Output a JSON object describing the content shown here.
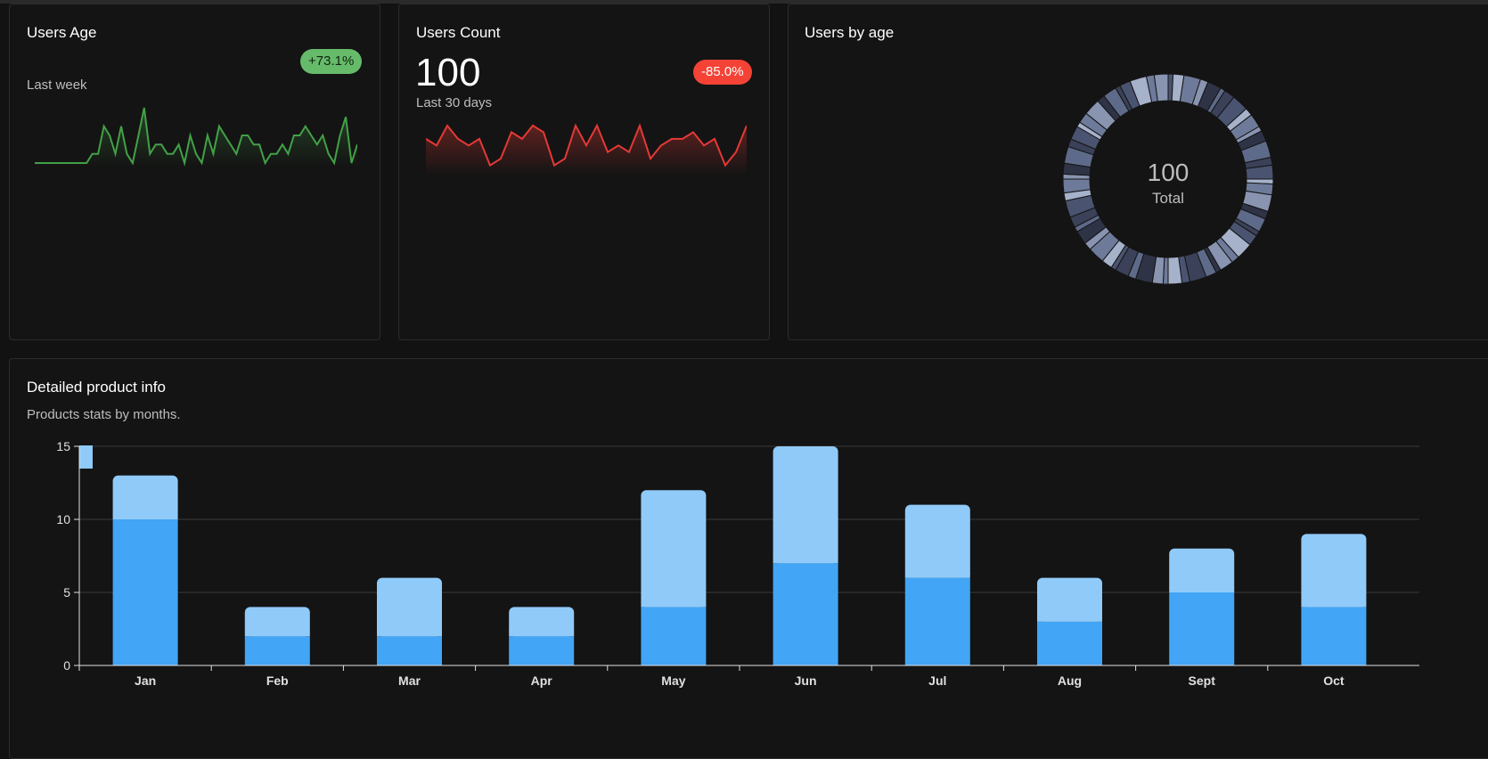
{
  "cards": {
    "users_age": {
      "title": "Users Age",
      "badge": "+73.1%",
      "period": "Last week",
      "badge_color": "#66bb6a",
      "line_color": "#43a047"
    },
    "users_count": {
      "title": "Users Count",
      "value": "100",
      "badge": "-85.0%",
      "period": "Last 30 days",
      "badge_color": "#f44336",
      "line_color": "#e53935"
    },
    "users_by_age": {
      "title": "Users by age",
      "center_value": "100",
      "center_label": "Total"
    },
    "product": {
      "title": "Detailed product info",
      "subtitle": "Products stats by months."
    }
  },
  "sparkline_age": [
    0,
    0,
    0,
    0,
    0,
    0,
    0,
    0,
    0,
    0,
    1,
    1,
    4,
    3,
    1,
    4,
    1,
    0,
    3,
    6,
    1,
    2,
    2,
    1,
    1,
    2,
    0,
    3,
    1,
    0,
    3,
    1,
    4,
    3,
    2,
    1,
    3,
    3,
    2,
    2,
    0,
    1,
    1,
    2,
    1,
    3,
    3,
    4,
    3,
    2,
    3,
    1,
    0,
    3,
    5,
    0,
    2
  ],
  "sparkline_count": [
    5,
    4,
    7,
    5,
    4,
    5,
    1,
    2,
    6,
    5,
    7,
    6,
    1,
    2,
    7,
    4,
    7,
    3,
    4,
    3,
    7,
    2,
    4,
    5,
    5,
    6,
    4,
    5,
    1,
    3,
    7
  ],
  "chart_data": {
    "type": "bar",
    "stacked": true,
    "categories": [
      "Jan",
      "Feb",
      "Mar",
      "Apr",
      "May",
      "Jun",
      "Jul",
      "Aug",
      "Sept",
      "Oct"
    ],
    "series": [
      {
        "values": [
          10,
          2,
          2,
          2,
          4,
          7,
          6,
          3,
          5,
          4
        ],
        "color": "#42a5f5"
      },
      {
        "values": [
          3,
          2,
          4,
          2,
          8,
          8,
          5,
          3,
          3,
          5
        ],
        "color": "#90caf9"
      }
    ],
    "ylim": [
      0,
      15
    ],
    "yticks": [
      0,
      5,
      10,
      15
    ],
    "grid": true
  },
  "donut": {
    "colors": [
      "#4a5470",
      "#5e6a89",
      "#8894b0",
      "#a6b1ca",
      "#3a4158",
      "#2e3446",
      "#6e7a99"
    ],
    "segments": 60
  }
}
